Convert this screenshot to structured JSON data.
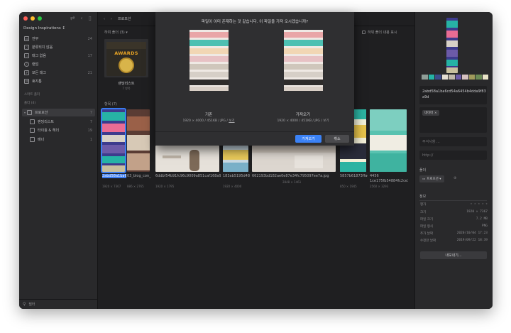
{
  "sidebar": {
    "library_name": "Design Inspirations ↕",
    "items": [
      {
        "label": "전부",
        "count": "24",
        "icon": "all-icon"
      },
      {
        "label": "분류되지 않음",
        "count": "",
        "icon": "unsorted-icon"
      },
      {
        "label": "태그 없음",
        "count": "17",
        "icon": "untagged-icon"
      },
      {
        "label": "랜덤",
        "count": "",
        "icon": "random-icon"
      },
      {
        "label": "모든 태그",
        "count": "21",
        "icon": "tag-icon"
      },
      {
        "label": "휴지통",
        "count": "",
        "icon": "trash-icon"
      }
    ],
    "smart_folder_heading": "스마트 폴더",
    "folder_heading": "폴더 (4)",
    "folders": [
      {
        "label": "프로모션",
        "count": "7",
        "selected": true
      },
      {
        "label": "랜딩리스트",
        "count": "7"
      },
      {
        "label": "타이틀 & 헤더",
        "count": "19"
      },
      {
        "label": "배너",
        "count": "1"
      }
    ],
    "search_placeholder": "필터"
  },
  "toolbar": {
    "breadcrumb": "프로모션"
  },
  "main": {
    "subfolder_heading": "하위 폴더 (3) ▾",
    "show_subfolder_content": "하위 폴더 내용 표시",
    "subfolder": {
      "name": "랜딩리스트",
      "count": "7 항목",
      "awards_text": "AWARDS"
    },
    "content_heading": "항목 (7)",
    "items": [
      {
        "name": "2abd58a1ba6cd5...",
        "dims": "1920 × 7367"
      },
      {
        "name": "03_blog_con_886xfree...",
        "dims": "886 × 2765"
      },
      {
        "name": "6ddbf54b91fc96c9009a851caf168a9d.jpg",
        "dims": "1920 × 1795"
      },
      {
        "name": "183ab5195d48202539f...",
        "dims": "1920 × 4000"
      },
      {
        "name": "662193bd182ae0e87e34fc795097ee7a.jpg",
        "dims": "2848 × 1461"
      },
      {
        "name": "5857b61873ffaea479ddd...",
        "dims": "850 × 1945"
      },
      {
        "name": "4456 1ce175fb54884fc2ce3620154...",
        "dims": "2560 × 3293"
      }
    ]
  },
  "modal": {
    "title": "파일이 이미 존재하는 것 같습니다. 이 파일을 가져 오시겠습니까?",
    "existing_label": "기존",
    "existing_meta": "1920 × 4000 / 451KB / JPG / ",
    "existing_link": "보기",
    "import_label": "가져오기",
    "import_meta": "1920 × 4000 / 451KB / JPG / 보기",
    "confirm_button": "가져오기",
    "cancel_button": "취소"
  },
  "inspector": {
    "palette": [
      "#8f9d97",
      "#25b3a5",
      "#3c4a8a",
      "#e4ded2",
      "#bfb7aa",
      "#6c5aa8",
      "#d6c1c0",
      "#9f9a5b",
      "#6a8a55",
      "#e8e3c7"
    ],
    "file_name": "2abd58a1ba6cd54a6454b4dda9f83a9d",
    "tag": "네이버 ×",
    "notes_placeholder": "주석사항 ...",
    "url_placeholder": "http://",
    "folder_heading": "폴더",
    "folder_value": "프로모션 ▾",
    "info_heading": "정보",
    "info": [
      {
        "key": "평가",
        "value": "★ ★ ★ ★ ★"
      },
      {
        "key": "크기",
        "value": "1920 × 7367"
      },
      {
        "key": "파일 크기",
        "value": "7.2 MB"
      },
      {
        "key": "파일 형식",
        "value": "PNG"
      },
      {
        "key": "추가 날짜",
        "value": "2020/10/04 17:23"
      },
      {
        "key": "수정한 날짜",
        "value": "2019/09/22 18:39"
      }
    ],
    "export_button": "내보내기..."
  }
}
